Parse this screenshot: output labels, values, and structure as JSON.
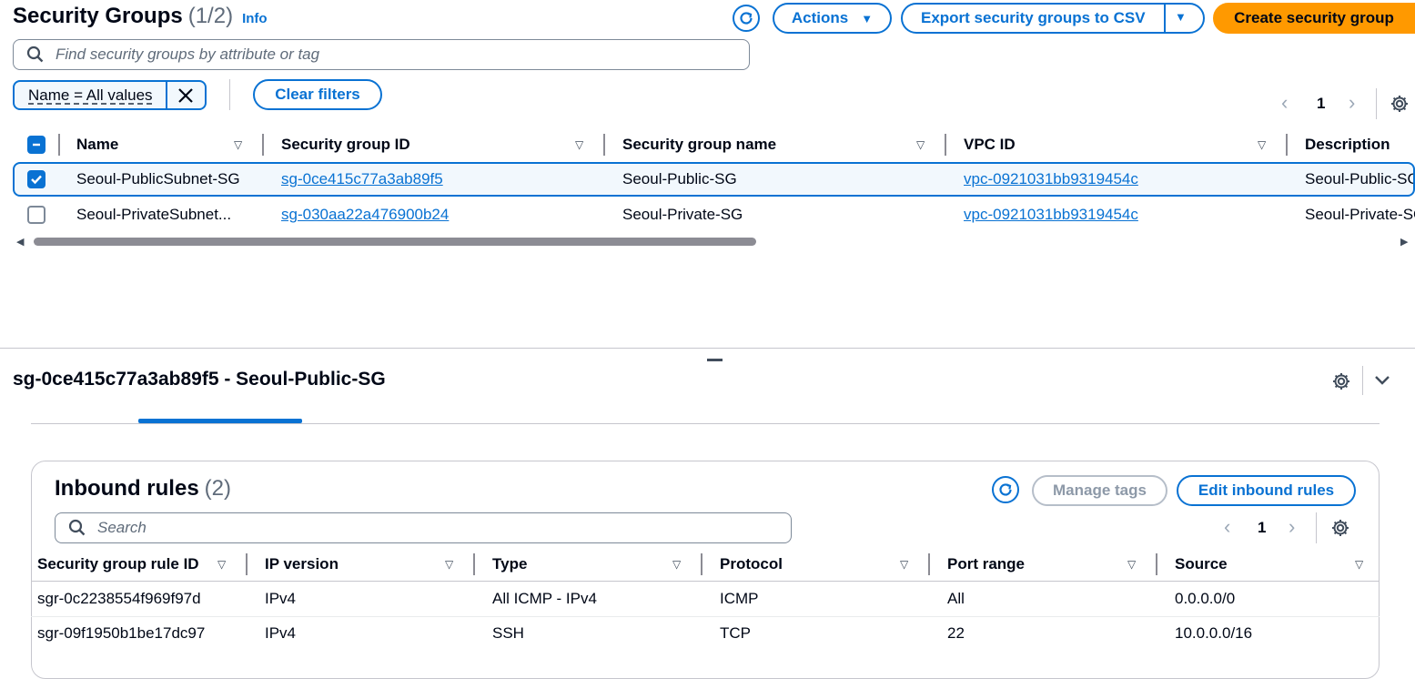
{
  "header": {
    "title": "Security Groups",
    "count": "(1/2)",
    "info": "Info",
    "actions_label": "Actions",
    "export_label": "Export security groups to CSV",
    "create_label": "Create security group"
  },
  "search": {
    "placeholder": "Find security groups by attribute or tag"
  },
  "filters": {
    "token": "Name = All values",
    "clear_label": "Clear filters"
  },
  "pagination": {
    "page": "1"
  },
  "table": {
    "columns": [
      "Name",
      "Security group ID",
      "Security group name",
      "VPC ID",
      "Description"
    ],
    "rows": [
      {
        "selected": true,
        "name": "Seoul-PublicSubnet-SG",
        "sg_id": "sg-0ce415c77a3ab89f5",
        "sg_name": "Seoul-Public-SG",
        "vpc_id": "vpc-0921031bb9319454c",
        "description": "Seoul-Public-SG"
      },
      {
        "selected": false,
        "name": "Seoul-PrivateSubnet...",
        "sg_id": "sg-030aa22a476900b24",
        "sg_name": "Seoul-Private-SG",
        "vpc_id": "vpc-0921031bb9319454c",
        "description": "Seoul-Private-SG"
      }
    ]
  },
  "detail": {
    "title": "sg-0ce415c77a3ab89f5 - Seoul-Public-SG"
  },
  "inbound": {
    "title": "Inbound rules",
    "count": "(2)",
    "manage_tags_label": "Manage tags",
    "edit_label": "Edit inbound rules",
    "search_placeholder": "Search",
    "page": "1",
    "columns": [
      "Security group rule ID",
      "IP version",
      "Type",
      "Protocol",
      "Port range",
      "Source"
    ],
    "rows": [
      {
        "rule_id": "sgr-0c2238554f969f97d",
        "ip_version": "IPv4",
        "type": "All ICMP - IPv4",
        "protocol": "ICMP",
        "port_range": "All",
        "source": "0.0.0.0/0"
      },
      {
        "rule_id": "sgr-09f1950b1be17dc97",
        "ip_version": "IPv4",
        "type": "SSH",
        "protocol": "TCP",
        "port_range": "22",
        "source": "10.0.0.0/16"
      }
    ]
  },
  "colors": {
    "accent": "#0972d3",
    "primary_button": "#ff9900",
    "selected_row_bg": "#f2f8fd"
  }
}
